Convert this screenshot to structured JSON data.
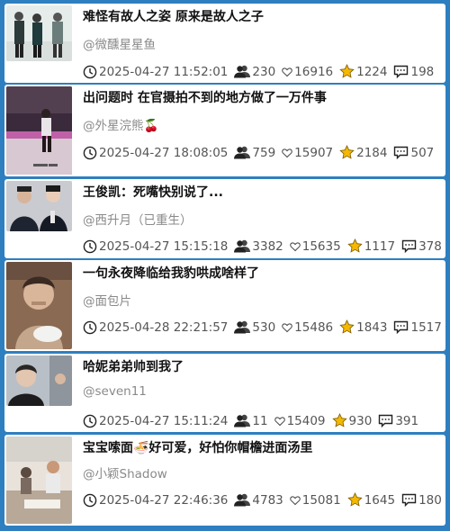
{
  "icons": {
    "time": "clock-icon",
    "views": "people-icon",
    "likes": "heart-icon",
    "favorites": "star-icon",
    "comments": "comment-icon"
  },
  "colors": {
    "background": "#2e7fc0",
    "star": "#f5b800"
  },
  "posts": [
    {
      "title": "难怪有故人之姿 原来是故人之子",
      "author": "@微醺星星鱼",
      "time": "2025-04-27 11:52:01",
      "views": "230",
      "likes": "16916",
      "favorites": "1224",
      "comments": "198"
    },
    {
      "title": "出问题时 在官摄拍不到的地方做了一万件事",
      "author": "@外星浣熊🍒",
      "time": "2025-04-27 18:08:05",
      "views": "759",
      "likes": "15907",
      "favorites": "2184",
      "comments": "507"
    },
    {
      "title": "王俊凯：死嘴快别说了...",
      "author": "@西升月（已重生）",
      "time": "2025-04-27 15:15:18",
      "views": "3382",
      "likes": "15635",
      "favorites": "1117",
      "comments": "378"
    },
    {
      "title": "一句永夜降临给我豹哄成啥样了",
      "author": "@面包片",
      "time": "2025-04-28 22:21:57",
      "views": "530",
      "likes": "15486",
      "favorites": "1843",
      "comments": "1517"
    },
    {
      "title": "哈妮弟弟帅到我了",
      "author": "@seven11",
      "time": "2025-04-27 15:11:24",
      "views": "11",
      "likes": "15409",
      "favorites": "930",
      "comments": "391"
    },
    {
      "title": "宝宝嗦面🍜好可爱，好怕你帽檐进面汤里",
      "author": "@小颖Shadow",
      "time": "2025-04-27 22:46:36",
      "views": "4783",
      "likes": "15081",
      "favorites": "1645",
      "comments": "180"
    }
  ]
}
